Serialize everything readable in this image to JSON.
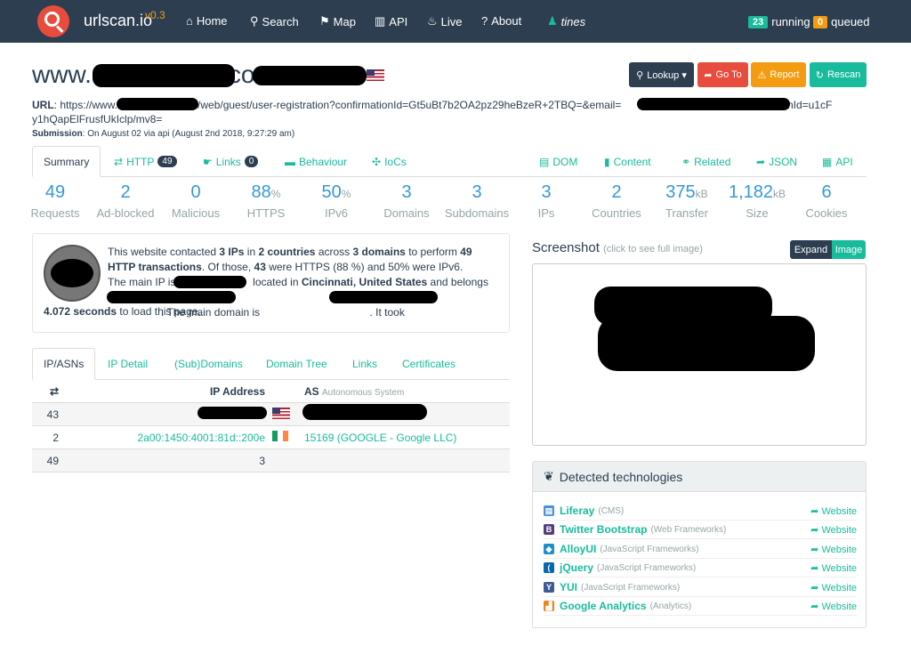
{
  "nav": {
    "brand": "urlscan.io",
    "version": "v0.3",
    "items": [
      {
        "icon": "home-icon",
        "glyph": "⌂",
        "label": "Home"
      },
      {
        "icon": "search-icon",
        "glyph": "⚲",
        "label": "Search"
      },
      {
        "icon": "map-marker-icon",
        "glyph": "⚑",
        "label": "Map"
      },
      {
        "icon": "barcode-icon",
        "glyph": "▥",
        "label": "API"
      },
      {
        "icon": "fire-icon",
        "glyph": "♨",
        "label": "Live"
      },
      {
        "icon": "question-icon",
        "glyph": "?",
        "label": "About"
      },
      {
        "icon": "user-icon",
        "glyph": "♟",
        "label": "tines"
      }
    ],
    "running_count": "23",
    "running_label": "running",
    "queued_count": "0",
    "queued_label": "queued",
    "colors": {
      "running": "#18bc9c",
      "queued": "#f39c12"
    }
  },
  "header": {
    "title_prefix": "www.",
    "title_suffix": "com",
    "buttons": {
      "lookup": "Lookup ▾",
      "goto": "Go To",
      "report": "Report",
      "rescan": "Rescan"
    },
    "url_label": "URL",
    "url_part1": ": https://www.",
    "url_part2": "/web/guest/user-registration?confirmationId=Gt5uBt7b2OA2pz29heBzeR+2TBQ=&email=",
    "url_part3": "tokenId=u1cF",
    "url_part4": "y1hQapElFrusfUkIclp/mv8=",
    "submission_label": "Submission",
    "submission_text": ": On August 02 via api (August 2nd 2018, 9:27:29 am)"
  },
  "tabs": {
    "summary": "Summary",
    "http": "HTTP",
    "http_count": "49",
    "links": "Links",
    "links_count": "0",
    "behaviour": "Behaviour",
    "iocs": "IoCs",
    "dom": "DOM",
    "content": "Content",
    "related": "Related",
    "json": "JSON",
    "api": "API"
  },
  "stats": [
    {
      "value": "49",
      "unit": "",
      "label": "Requests"
    },
    {
      "value": "2",
      "unit": "",
      "label": "Ad-blocked"
    },
    {
      "value": "0",
      "unit": "",
      "label": "Malicious"
    },
    {
      "value": "88",
      "unit": "%",
      "label": "HTTPS"
    },
    {
      "value": "50",
      "unit": "%",
      "label": "IPv6"
    },
    {
      "value": "3",
      "unit": "",
      "label": "Domains"
    },
    {
      "value": "3",
      "unit": "",
      "label": "Subdomains"
    },
    {
      "value": "3",
      "unit": "",
      "label": "IPs"
    },
    {
      "value": "2",
      "unit": "",
      "label": "Countries"
    },
    {
      "value": "375",
      "unit": "kB",
      "label": "Transfer"
    },
    {
      "value": "1,182",
      "unit": "kB",
      "label": "Size"
    },
    {
      "value": "6",
      "unit": "",
      "label": "Cookies"
    }
  ],
  "summary": {
    "t1": "This website contacted ",
    "ips": "3 IPs",
    "t2": " in ",
    "countries": "2 countries",
    "t3": " across ",
    "domains": "3 domains",
    "t4": " to perform ",
    "http": "49 HTTP transactions",
    "t5": ". Of those, ",
    "https": "43",
    "t6": " were HTTPS (88 %) and 50% were IPv6.",
    "t7": "The main IP is ",
    "t8": " located in ",
    "location": "Cincinnati, United States",
    "t9": " and belongs to",
    "t10": ". The main domain is ",
    "t11": ". It took",
    "load_time": "4.072 seconds",
    "t12": " to load this page."
  },
  "subtabs": [
    "IP/ASNs",
    "IP Detail",
    "(Sub)Domains",
    "Domain Tree",
    "Links",
    "Certificates"
  ],
  "table": {
    "header": {
      "ip": "IP Address",
      "as": "AS",
      "as_sub": "Autonomous System"
    },
    "rows": [
      {
        "count": "43",
        "ip": "",
        "as": ""
      },
      {
        "count": "2",
        "ip": "2a00:1450:4001:81d::200e",
        "as": "15169 (GOOGLE - Google LLC)"
      },
      {
        "count": "49",
        "ip": "3",
        "as": ""
      }
    ]
  },
  "screenshot": {
    "title": "Screenshot",
    "hint": "(click to see full image)",
    "expand": "Expand",
    "image": "Image"
  },
  "tech": {
    "title": "Detected technologies",
    "link_label": "Website",
    "items": [
      {
        "name": "Liferay",
        "cat": "(CMS)",
        "color": "#4a90d9",
        "glyph": "▤"
      },
      {
        "name": "Twitter Bootstrap",
        "cat": "(Web Frameworks)",
        "color": "#563d7c",
        "glyph": "B"
      },
      {
        "name": "AlloyUI",
        "cat": "(JavaScript Frameworks)",
        "color": "#1f8ec9",
        "glyph": "◆"
      },
      {
        "name": "jQuery",
        "cat": "(JavaScript Frameworks)",
        "color": "#0769ad",
        "glyph": "("
      },
      {
        "name": "YUI",
        "cat": "(JavaScript Frameworks)",
        "color": "#3d5a98",
        "glyph": "Y"
      },
      {
        "name": "Google Analytics",
        "cat": "(Analytics)",
        "color": "#f4811f",
        "glyph": "▟"
      }
    ]
  }
}
